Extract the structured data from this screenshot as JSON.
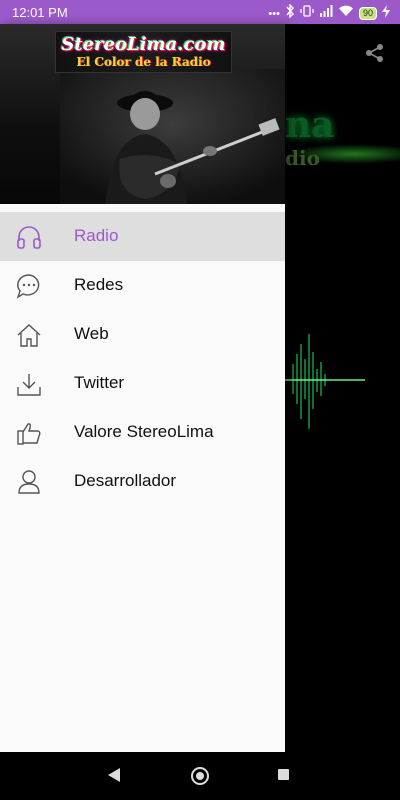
{
  "status_bar": {
    "time": "12:01 PM",
    "battery": "90",
    "icons": [
      "more-dots-icon",
      "bluetooth-icon",
      "vibrate-icon",
      "signal-icon",
      "wifi-icon",
      "battery-icon",
      "charging-icon"
    ]
  },
  "header": {
    "logo_title": "StereoLima.com",
    "logo_subtitle": "El Color de la Radio"
  },
  "background_app": {
    "logo_partial": "na",
    "subtitle_partial": "dio"
  },
  "menu": {
    "items": [
      {
        "label": "Radio",
        "icon": "headphones-icon",
        "active": true
      },
      {
        "label": "Redes",
        "icon": "chat-bubble-icon",
        "active": false
      },
      {
        "label": "Web",
        "icon": "home-icon",
        "active": false
      },
      {
        "label": "Twitter",
        "icon": "download-icon",
        "active": false
      },
      {
        "label": "Valore StereoLima",
        "icon": "thumbs-up-icon",
        "active": false
      },
      {
        "label": "Desarrollador",
        "icon": "user-icon",
        "active": false
      }
    ]
  },
  "colors": {
    "accent": "#9b59c9",
    "active_bg": "#dedede",
    "drawer_bg": "#fafafa"
  },
  "nav_bar": {
    "buttons": [
      "back-icon",
      "home-circle-icon",
      "recents-icon"
    ]
  }
}
